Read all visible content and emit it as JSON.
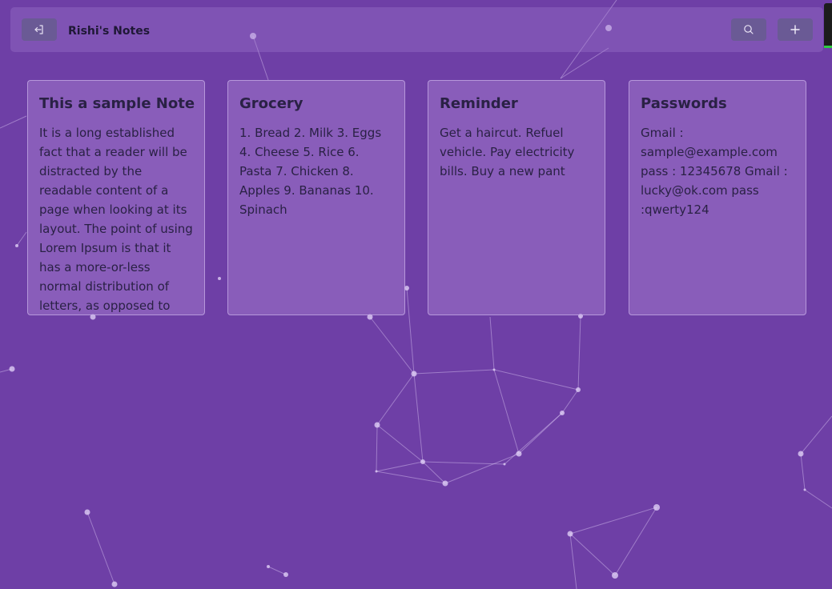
{
  "app": {
    "title": "Rishi's Notes"
  },
  "toolbar": {
    "back_icon": "logout-arrow-icon",
    "search_icon": "search-icon",
    "add_icon": "plus-icon"
  },
  "notes": [
    {
      "title": "This a sample Note",
      "body": "It is a long established fact that a reader will be distracted by the readable content of a page when looking at its layout. The point of using Lorem Ipsum is that it has a more-or-less normal distribution of letters, as opposed to using..."
    },
    {
      "title": "Grocery",
      "body": "1. Bread 2. Milk 3. Eggs 4. Cheese 5. Rice 6. Pasta 7. Chicken 8. Apples 9. Bananas 10. Spinach"
    },
    {
      "title": "Reminder",
      "body": "Get a haircut. Refuel vehicle. Pay electricity bills. Buy a new pant"
    },
    {
      "title": "Passwords",
      "body": "Gmail : sample@example.com pass : 12345678 Gmail : lucky@ok.com pass :qwerty124"
    }
  ],
  "colors": {
    "background": "#6e3fa6",
    "card": "#a582d2",
    "button": "#6a5a95",
    "text": "#2a2145"
  }
}
